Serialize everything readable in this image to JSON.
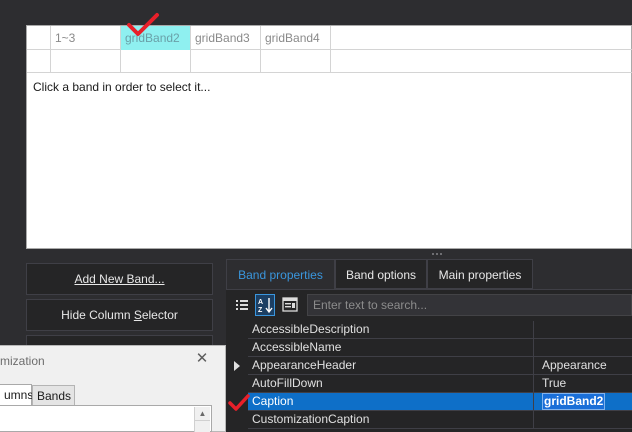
{
  "band_designer": {
    "bands": [
      {
        "label": "",
        "selected": false
      },
      {
        "label": "1~3",
        "selected": false
      },
      {
        "label": "gridBand2",
        "selected": true
      },
      {
        "label": "gridBand3",
        "selected": false
      },
      {
        "label": "gridBand4",
        "selected": false
      }
    ],
    "hint": "Click a band in order to select it..."
  },
  "buttons": {
    "add_new_band": "Add New Band...",
    "hide_column_selector_pre": "Hide Column ",
    "hide_column_selector_mnemonic": "S",
    "hide_column_selector_post": "elector"
  },
  "customization": {
    "title": "mization",
    "tabs": [
      {
        "label": "umns",
        "active": true
      },
      {
        "label": "Bands",
        "active": false
      }
    ]
  },
  "properties": {
    "tabs": [
      {
        "label": "Band properties",
        "active": true
      },
      {
        "label": "Band options",
        "active": false
      },
      {
        "label": "Main properties",
        "active": false
      }
    ],
    "search_placeholder": "Enter text to search...",
    "rows": [
      {
        "name": "AccessibleDescription",
        "value": ""
      },
      {
        "name": "AccessibleName",
        "value": ""
      },
      {
        "name": "AppearanceHeader",
        "value": "Appearance"
      },
      {
        "name": "AutoFillDown",
        "value": "True"
      },
      {
        "name": "Caption",
        "value": "gridBand2"
      },
      {
        "name": "CustomizationCaption",
        "value": ""
      }
    ]
  },
  "colors": {
    "accent": "#3a96dd",
    "selection": "#0e6fc8",
    "selected_band": "#8ff0f0",
    "check_mark": "#e8202a"
  }
}
